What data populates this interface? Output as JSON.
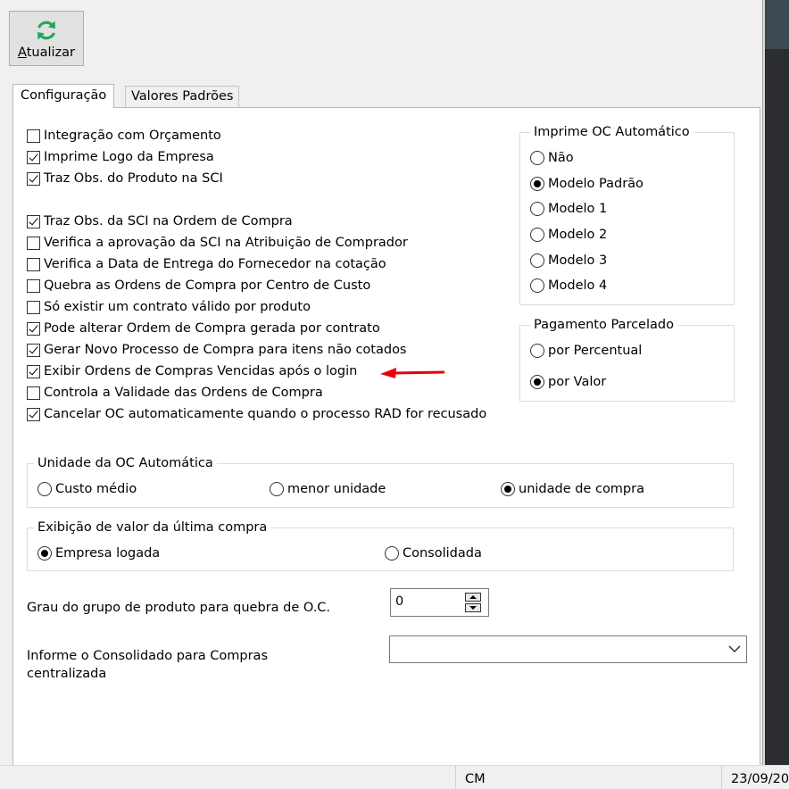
{
  "toolbar": {
    "refresh_label_underlined": "A",
    "refresh_label_rest": "tualizar"
  },
  "tabs": [
    {
      "label": "Configuração",
      "selected": true
    },
    {
      "label": "Valores Padrões",
      "selected": false
    }
  ],
  "checkboxes": [
    {
      "label": "Integração com Orçamento",
      "checked": false
    },
    {
      "label": "Imprime Logo da Empresa",
      "checked": true
    },
    {
      "label": "Traz Obs. do Produto na SCI",
      "checked": true
    },
    {
      "label": "Traz Obs. da SCI na Ordem de Compra",
      "checked": true
    },
    {
      "label": "Verifica a aprovação da SCI na Atribuição de Comprador",
      "checked": false
    },
    {
      "label": "Verifica a Data de Entrega do Fornecedor na cotação",
      "checked": false
    },
    {
      "label": "Quebra as Ordens de Compra por Centro de Custo",
      "checked": false
    },
    {
      "label": "Só existir um contrato válido por produto",
      "checked": false
    },
    {
      "label": "Pode alterar Ordem de Compra gerada por contrato",
      "checked": true
    },
    {
      "label": "Gerar Novo Processo de Compra para itens não cotados",
      "checked": true
    },
    {
      "label": "Exibir Ordens de Compras Vencidas após o login",
      "checked": true
    },
    {
      "label": "Controla a Validade das Ordens de Compra",
      "checked": false
    },
    {
      "label": "Cancelar OC automaticamente quando o processo RAD for recusado",
      "checked": true
    }
  ],
  "imprime_oc": {
    "title": "Imprime OC Automático",
    "options": [
      {
        "label": "Não",
        "checked": false
      },
      {
        "label": "Modelo Padrão",
        "checked": true
      },
      {
        "label": "Modelo 1",
        "checked": false
      },
      {
        "label": "Modelo 2",
        "checked": false
      },
      {
        "label": "Modelo 3",
        "checked": false
      },
      {
        "label": "Modelo 4",
        "checked": false
      }
    ]
  },
  "pagamento": {
    "title": "Pagamento Parcelado",
    "options": [
      {
        "label": "por Percentual",
        "checked": false
      },
      {
        "label": "por Valor",
        "checked": true
      }
    ]
  },
  "unidade": {
    "title": "Unidade da OC Automática",
    "options": [
      {
        "label": "Custo médio",
        "checked": false
      },
      {
        "label": "menor unidade",
        "checked": false
      },
      {
        "label": "unidade de compra",
        "checked": true
      }
    ]
  },
  "exibicao": {
    "title": "Exibição de valor da última compra",
    "options": [
      {
        "label": "Empresa logada",
        "checked": true
      },
      {
        "label": "Consolidada",
        "checked": false
      }
    ]
  },
  "grau": {
    "label": "Grau do grupo de produto para quebra de O.C.",
    "value": "0"
  },
  "consolidado": {
    "label_line1": "Informe o Consolidado para Compras",
    "label_line2": "centralizada",
    "value": ""
  },
  "statusbar": {
    "cell2": "CM",
    "cell3": "23/09/20"
  },
  "colors": {
    "arrow": "#e8000b",
    "refresh_icon": "#1fa85c"
  }
}
